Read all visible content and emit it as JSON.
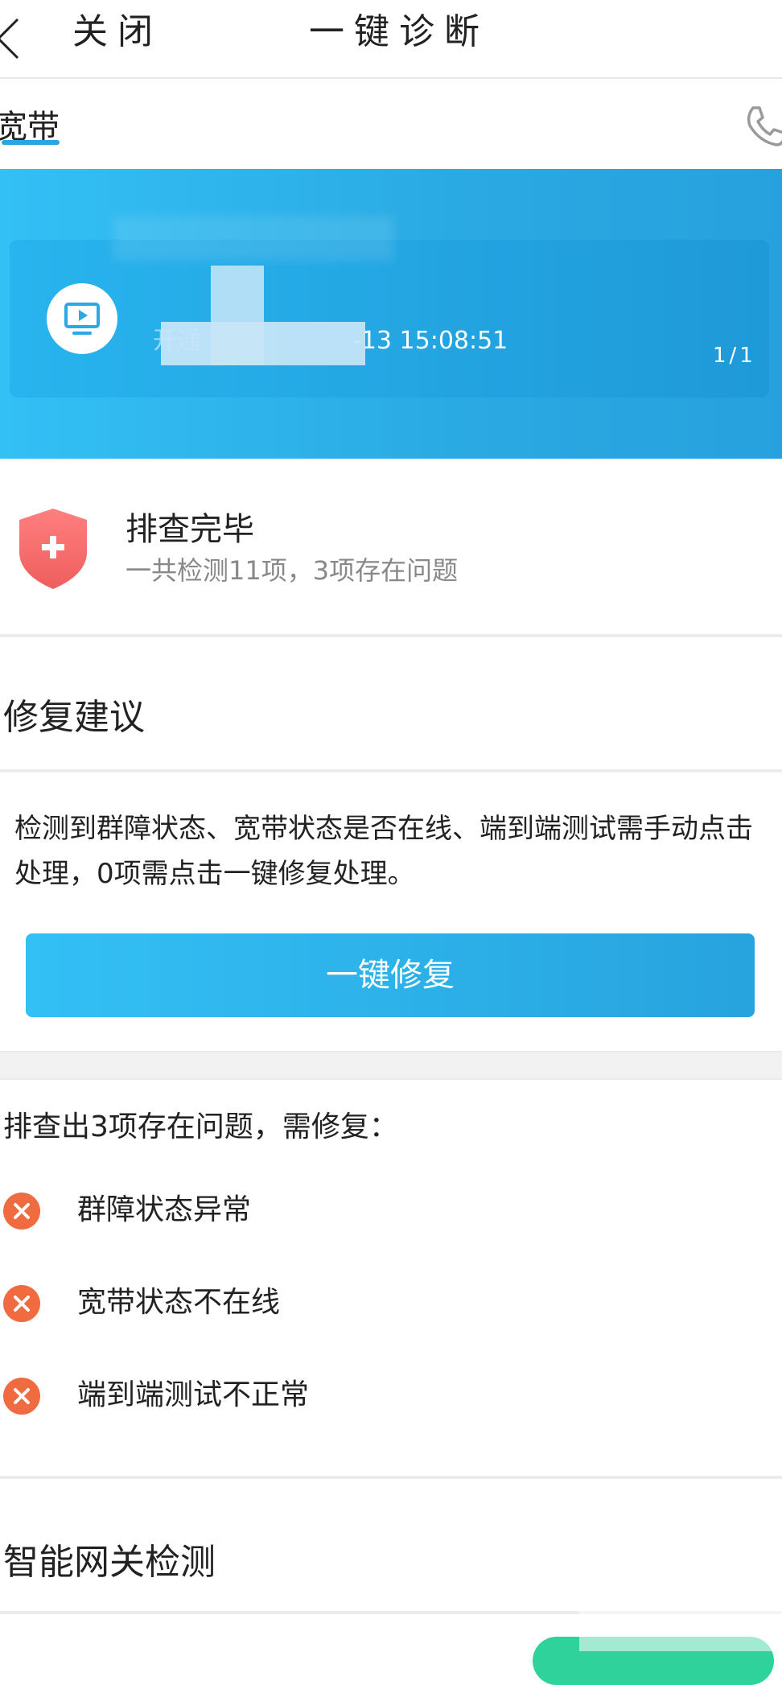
{
  "nav": {
    "close_label": "关闭",
    "title": "一键诊断"
  },
  "tab": {
    "label": "宽带"
  },
  "card": {
    "time_text": "开通时间：-13 15:08:51",
    "visible_time": "-13 15:08:51",
    "pager": "1/1"
  },
  "result": {
    "title": "排查完毕",
    "summary": "一共检测11项，3项存在问题"
  },
  "repair": {
    "title": "修复建议",
    "advice": "检测到群障状态、宽带状态是否在线、端到端测试需手动点击处理，0项需点击一键修复处理。",
    "button_label": "一键修复"
  },
  "issues": {
    "title": "排查出3项存在问题，需修复：",
    "items": [
      {
        "label": "群障状态异常"
      },
      {
        "label": "宽带状态不在线"
      },
      {
        "label": "端到端测试不正常"
      }
    ]
  },
  "gateway": {
    "title": "智能网关检测"
  },
  "colors": {
    "primary": "#2ba7de",
    "error": "#f06b3f",
    "shield": "#f26a6a",
    "green": "#2ed29a"
  },
  "icons": [
    "back-icon",
    "phone-icon",
    "tv-icon",
    "shield-plus-icon",
    "error-x-icon"
  ]
}
